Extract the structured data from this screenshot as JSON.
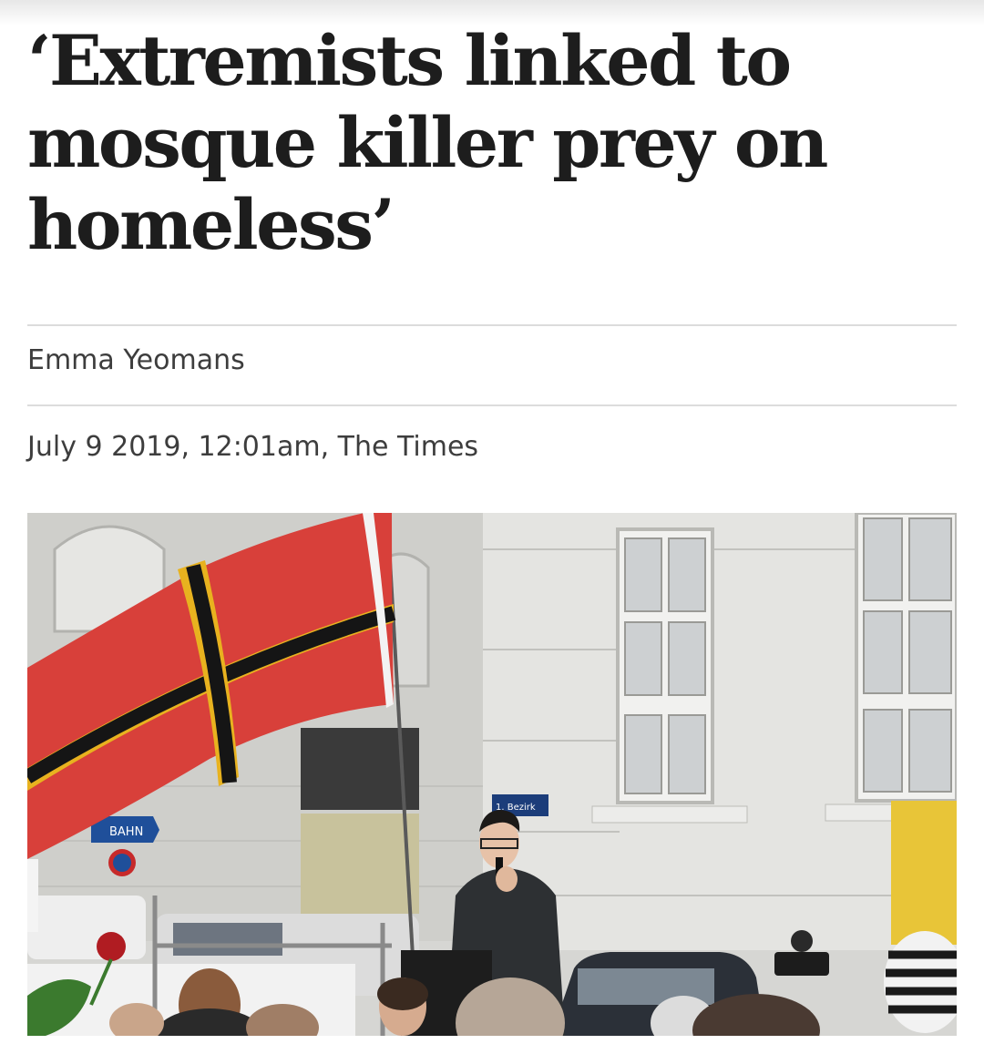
{
  "article": {
    "headline": "‘Extremists linked to mosque killer prey on homeless’",
    "author": "Emma Yeomans",
    "dateline": "July 9 2019, 12:01am, The Times"
  },
  "photo": {
    "sign_left": "BAHN",
    "sign_street": "1. Bezirk"
  }
}
